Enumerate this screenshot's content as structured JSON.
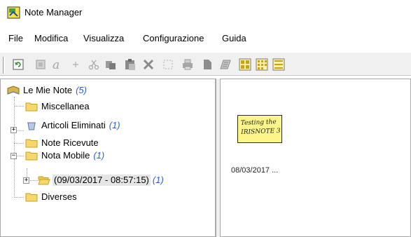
{
  "window": {
    "title": "Note Manager"
  },
  "menu": {
    "items": [
      "File",
      "Modifica",
      "Visualizza",
      "Configurazione",
      "Guida"
    ]
  },
  "toolbar": {
    "buttons": [
      "refresh-icon",
      "new-note-icon",
      "font-icon",
      "add-icon",
      "cut-icon",
      "copy-icon",
      "paste-icon",
      "delete-icon",
      "select-icon",
      "print-icon",
      "document-icon",
      "note-properties-icon",
      "view-large-icons-icon",
      "view-small-icons-icon",
      "view-list-icon"
    ]
  },
  "tree": {
    "root": {
      "label": "Le Mie Note",
      "count": "(5)"
    },
    "items": [
      {
        "label": "Miscellanea",
        "count": ""
      },
      {
        "label": "Articoli Eliminati",
        "count": "(1)"
      },
      {
        "label": "Note Ricevute",
        "count": ""
      },
      {
        "label": "Nota Mobile",
        "count": "(1)"
      },
      {
        "label": "(09/03/2017 - 08:57:15)",
        "count": "(1)"
      },
      {
        "label": "Diverses",
        "count": ""
      }
    ]
  },
  "notes": [
    {
      "handwriting_line1": "Testing the",
      "handwriting_line2": "IRISNOTE 3",
      "caption": "08/03/2017 ..."
    }
  ],
  "colors": {
    "note_yellow": "#fbf58a",
    "count_blue": "#2a5fd6",
    "folder_yellow": "#f5d76e"
  }
}
